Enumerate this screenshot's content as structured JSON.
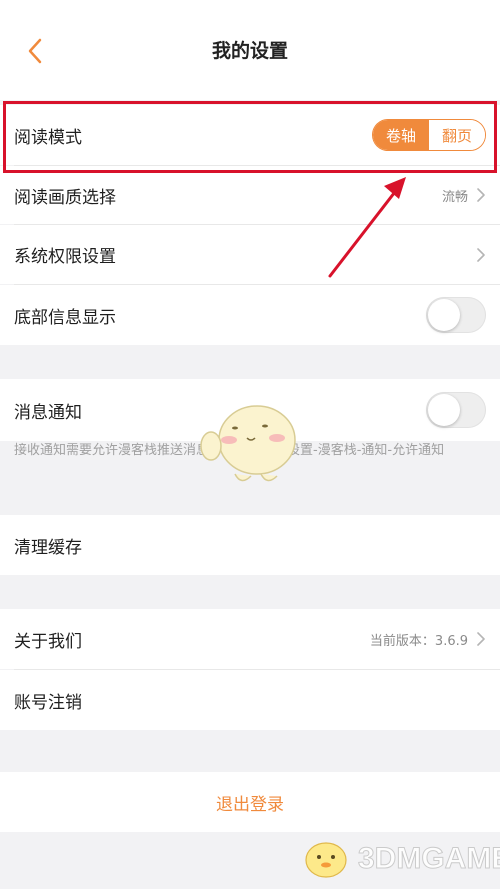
{
  "header": {
    "title": "我的设置",
    "back_icon": "chevron-left-icon"
  },
  "accent_color": "#f08a3c",
  "annotation_color": "#d8122b",
  "settings": {
    "reading_mode": {
      "label": "阅读模式",
      "options": [
        "卷轴",
        "翻页"
      ],
      "selected": "卷轴"
    },
    "reading_quality": {
      "label": "阅读画质选择",
      "value": "流畅"
    },
    "system_permissions": {
      "label": "系统权限设置"
    },
    "bottom_info": {
      "label": "底部信息显示",
      "enabled": false
    },
    "notifications": {
      "label": "消息通知",
      "enabled": false,
      "hint": "接收通知需要允许漫客栈推送消息，打开方法：设置-漫客栈-通知-允许通知"
    },
    "clear_cache": {
      "label": "清理缓存"
    },
    "about": {
      "label": "关于我们",
      "value": "当前版本：3.6.9"
    },
    "account_deletion": {
      "label": "账号注销"
    },
    "logout": {
      "label": "退出登录"
    }
  },
  "watermark": {
    "text": "3DMGAME"
  }
}
